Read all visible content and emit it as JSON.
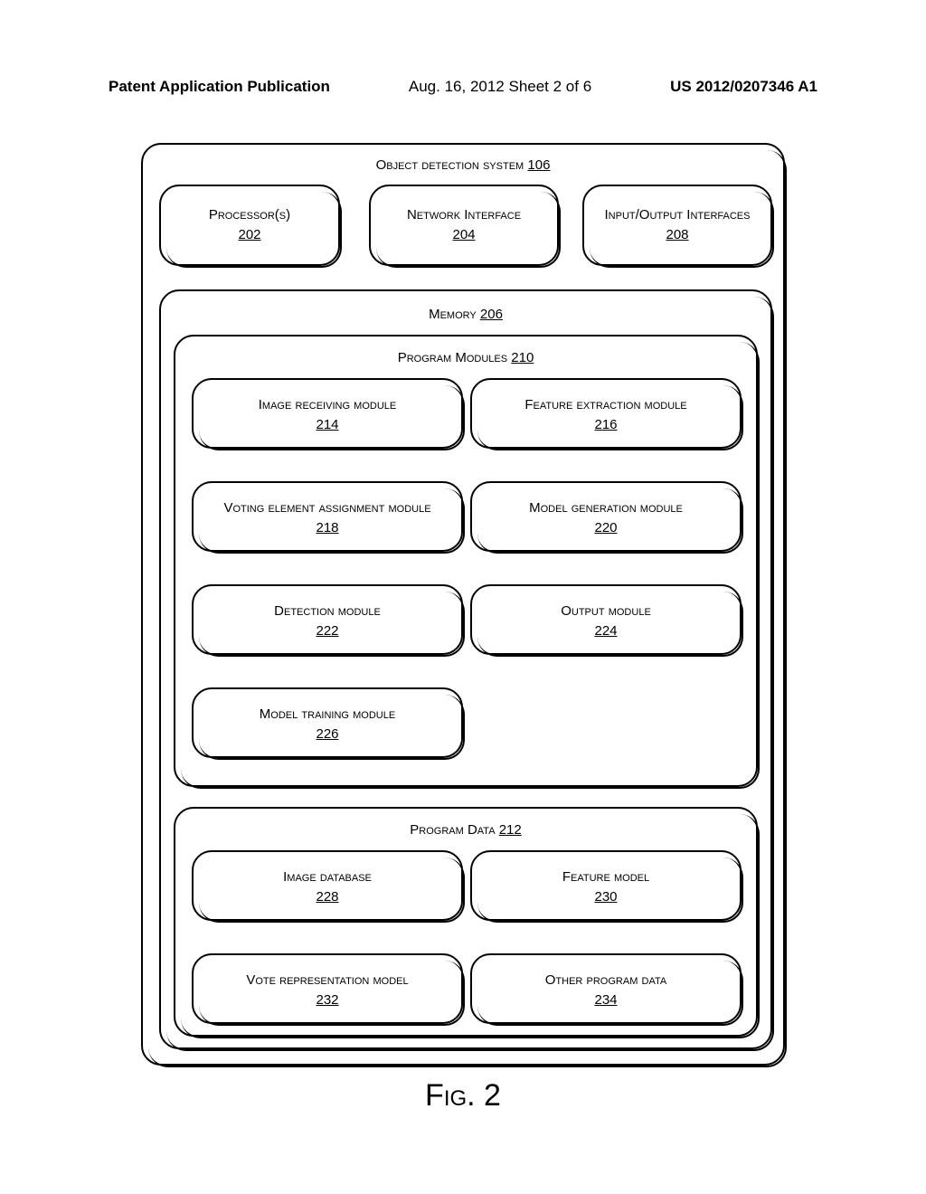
{
  "header": {
    "left": "Patent Application Publication",
    "middle": "Aug. 16, 2012  Sheet 2 of 6",
    "right": "US 2012/0207346 A1"
  },
  "system": {
    "label": "Object detection system",
    "num": "106"
  },
  "top_row": [
    {
      "label": "Processor(s)",
      "num": "202"
    },
    {
      "label": "Network Interface",
      "num": "204"
    },
    {
      "label": "Input/Output Interfaces",
      "num": "208"
    }
  ],
  "memory": {
    "label": "Memory",
    "num": "206"
  },
  "program_modules": {
    "label": "Program Modules",
    "num": "210",
    "items": [
      {
        "label": "Image receiving module",
        "num": "214"
      },
      {
        "label": "Feature extraction module",
        "num": "216"
      },
      {
        "label": "Voting element assignment module",
        "num": "218"
      },
      {
        "label": "Model generation module",
        "num": "220"
      },
      {
        "label": "Detection module",
        "num": "222"
      },
      {
        "label": "Output module",
        "num": "224"
      },
      {
        "label": "Model training module",
        "num": "226"
      }
    ]
  },
  "program_data": {
    "label": "Program Data",
    "num": "212",
    "items": [
      {
        "label": "Image database",
        "num": "228"
      },
      {
        "label": "Feature model",
        "num": "230"
      },
      {
        "label": "Vote representation model",
        "num": "232"
      },
      {
        "label": "Other program data",
        "num": "234"
      }
    ]
  },
  "figure_caption": "Fig. 2"
}
